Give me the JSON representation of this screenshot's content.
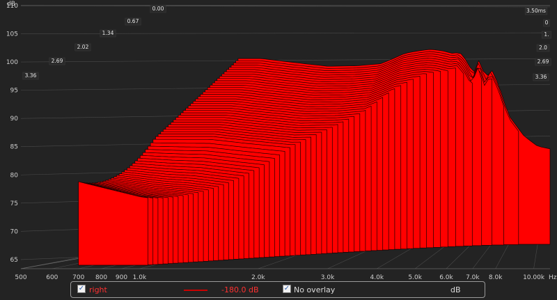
{
  "chart_data": {
    "type": "area",
    "subtype": "waterfall-3d",
    "ylabel": "dB",
    "ylim": [
      64,
      110
    ],
    "yticks": [
      65,
      70,
      75,
      80,
      85,
      90,
      95,
      100,
      105,
      110
    ],
    "xscale": "log",
    "xlim": [
      500,
      11000
    ],
    "xtick_values": [
      500,
      600,
      700,
      800,
      900,
      1000,
      2000,
      3000,
      4000,
      5000,
      6000,
      7000,
      8000,
      10000
    ],
    "xtick_labels": [
      "500",
      "600",
      "700",
      "800",
      "900",
      "1.0k",
      "2.0k",
      "3.0k",
      "4.0k",
      "5.0k",
      "6.0k",
      "7.0k",
      "8.0k",
      "10.00k"
    ],
    "x_unit": "Hz",
    "depth_ticks": [
      "0.00",
      "0.67",
      "1.34",
      "2.02",
      "2.69",
      "3.36"
    ],
    "depth_ticks_right": [
      "3.50ms",
      "0",
      "1.",
      "2.0",
      "2.69",
      "3.36"
    ],
    "grid": true,
    "colors": {
      "fill": "#ff0000",
      "edge": "#1a0000",
      "background": "#232323",
      "grid": "#4a4a4a"
    },
    "series_back": {
      "freqs": [
        1000,
        1200,
        1500,
        2000,
        2500,
        3000,
        3300,
        3600,
        4000,
        4400,
        4800,
        5200,
        5500,
        5800,
        6100,
        6400,
        6700,
        7000,
        7400,
        8000,
        9000,
        10000,
        11000
      ],
      "values": [
        100,
        100,
        99.3,
        98.5,
        98.6,
        99,
        100,
        101,
        101.5,
        101.8,
        101.5,
        101,
        101.2,
        99.5,
        97,
        100,
        96,
        98,
        95,
        89,
        85,
        83,
        82.5
      ]
    },
    "series_front": {
      "freqs": [
        500,
        700,
        1000
      ],
      "values": [
        80.5,
        80.6,
        79.5
      ]
    }
  },
  "legend": {
    "channel_label": "right",
    "line_color": "#cc0000",
    "level_text": "-180.0 dB",
    "overlay_label": "No overlay",
    "unit_label": "dB"
  }
}
